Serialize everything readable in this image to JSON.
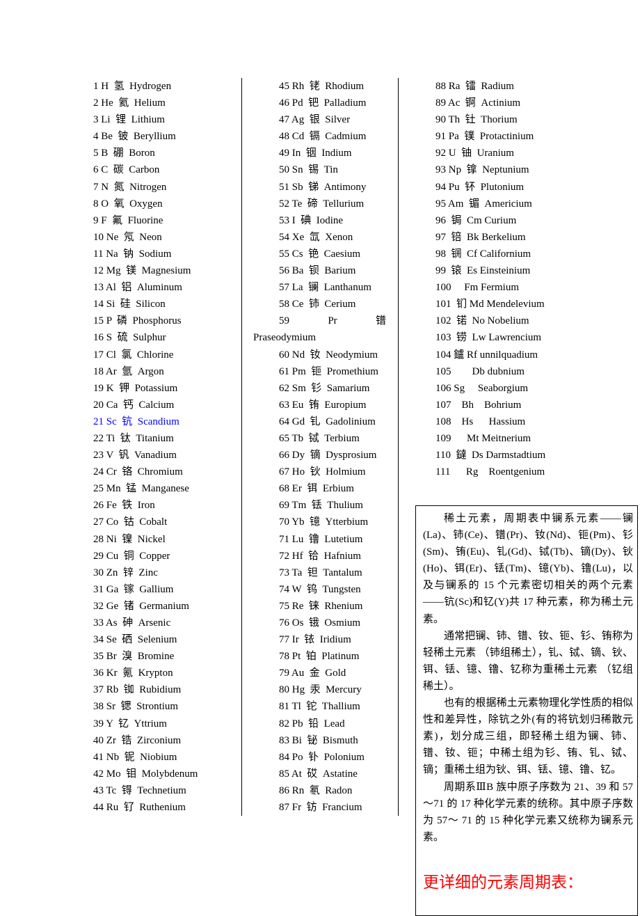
{
  "columns": [
    [
      "1 H  氢  Hydrogen",
      "2 He  氦  Helium",
      "3 Li  锂  Lithium",
      "4 Be  铍  Beryllium",
      "5 B  硼  Boron",
      "6 C  碳  Carbon",
      "7 N  氮  Nitrogen",
      "8 O  氧  Oxygen",
      "9 F  氟  Fluorine",
      "10 Ne  氖  Neon",
      "11 Na  钠  Sodium",
      "12 Mg  镁  Magnesium",
      "13 Al  铝  Aluminum",
      "14 Si  硅  Silicon",
      "15 P  磷  Phosphorus",
      "16 S  硫  Sulphur",
      "17 Cl  氯  Chlorine",
      "18 Ar  氩  Argon",
      "19 K  钾  Potassium",
      "20 Ca  钙  Calcium",
      "21 Sc  钪  Scandium",
      "22 Ti  钛  Titanium",
      "23 V  钒  Vanadium",
      "24 Cr  铬  Chromium",
      "25 Mn  锰  Manganese",
      "26 Fe  铁  Iron",
      "27 Co  钴  Cobalt",
      "28 Ni  镍  Nickel",
      "29 Cu  铜  Copper",
      "30 Zn  锌  Zinc",
      "31 Ga  镓  Gallium",
      "32 Ge  锗  Germanium",
      "33 As  砷  Arsenic",
      "34 Se  硒  Selenium",
      "35 Br  溴  Bromine",
      "36 Kr  氪  Krypton",
      "37 Rb  铷  Rubidium",
      "38 Sr  锶  Strontium",
      "39 Y  钇  Yttrium",
      "40 Zr  锆  Zirconium",
      "41 Nb  铌  Niobium",
      "42 Mo  钼  Molybdenum",
      "43 Tc  锝  Technetium",
      "44 Ru  钌  Ruthenium"
    ],
    [
      "45 Rh  铑  Rhodium",
      "46 Pd  钯  Palladium",
      "47 Ag  银  Silver",
      "48 Cd  镉  Cadmium",
      "49 In  铟  Indium",
      "50 Sn  锡  Tin",
      "51 Sb  锑  Antimony",
      "52 Te  碲  Tellurium",
      "53 I  碘  Iodine",
      "54 Xe  氙  Xenon",
      "55 Cs  铯  Caesium",
      "56 Ba  钡  Barium",
      "57 La  镧  Lanthanum",
      "58 Ce  铈  Cerium"
    ],
    [
      "60 Nd  钕  Neodymium",
      "61 Pm  钷  Promethium",
      "62 Sm  钐  Samarium",
      "63 Eu  铕  Europium",
      "64 Gd  钆  Gadolinium",
      "65 Tb  铽  Terbium",
      "66 Dy  镝  Dysprosium",
      "67 Ho  钬  Holmium",
      "68 Er  铒  Erbium",
      "69 Tm  铥  Thulium",
      "70 Yb  镱  Ytterbium",
      "71 Lu  镥  Lutetium",
      "72 Hf  铪  Hafnium",
      "73 Ta  钽  Tantalum",
      "74 W  钨  Tungsten",
      "75 Re  铼  Rhenium",
      "76 Os  锇  Osmium",
      "77 Ir  铱  Iridium",
      "78 Pt  铂  Platinum",
      "79 Au  金  Gold",
      "80 Hg  汞  Mercury",
      "81 Tl  铊  Thallium",
      "82 Pb  铅  Lead",
      "83 Bi  铋  Bismuth",
      "84 Po  钋  Polonium",
      "85 At  砹  Astatine",
      "86 Rn  氡  Radon",
      "87 Fr  钫  Francium"
    ],
    [
      "88 Ra  镭  Radium",
      "89 Ac  锕  Actinium",
      "90 Th  钍  Thorium",
      "91 Pa  镤  Protactinium",
      "92 U  铀  Uranium",
      "93 Np  镎  Neptunium",
      "94 Pu  钚  Plutonium",
      "95 Am  镅  Americium",
      "96  锔  Cm Curium",
      "97  锫  Bk Berkelium",
      "98  锎  Cf Californium",
      "99  锿  Es Einsteinium",
      "100     Fm Fermium",
      "101  钔 Md Mendelevium",
      "102  锘  No Nobelium",
      "103  铹  Lw Lawrencium",
      "104 鑪 Rf unnilquadium",
      "105        Db dubnium",
      "106 Sg     Seaborgium",
      "107    Bh    Bohrium",
      "108    Hs      Hassium",
      "109      Mt Meitnerium",
      "110  鐽  Ds Darmstadtium",
      "111      Rg    Roentgenium"
    ]
  ],
  "item59": {
    "num": "59",
    "sym": "Pr",
    "cn": "镨",
    "name": "Praseodymium"
  },
  "highlight_color": "#0000ff",
  "box": {
    "paragraphs": [
      "稀土元素，周期表中镧系元素——镧(La)、铈(Ce)、镨(Pr)、钕(Nd)、钷(Pm)、钐(Sm)、铕(Eu)、钆(Gd)、铽(Tb)、镝(Dy)、钬(Ho)、铒(Er)、铥(Tm)、镱(Yb)、镥(Lu)，以及与镧系的 15 个元素密切相关的两个元素——钪(Sc)和钇(Y)共 17 种元素，称为稀土元素。",
      "通常把镧、铈、镨、钕、钷、钐、铕称为轻稀土元素 （铈组稀土），钆、铽、镝、钬、铒、铥、镱、镥、钇称为重稀土元素 （钇组稀土）。",
      "也有的根据稀土元素物理化学性质的相似性和差异性，除钪之外(有的将钪划归稀散元素)，划分成三组，即轻稀土组为镧、铈、镨、钕、钷；中稀土组为钐、铕、钆、铽、镝；重稀土组为钬、铒、铥、镱、镥、钇。",
      "周期系ⅢB 族中原子序数为 21、39 和 57～71 的 17 种化学元素的统称。其中原子序数为 57～ 71 的 15 种化学元素又统称为镧系元素。"
    ],
    "more_link": "更详细的元素周期表：",
    "more_color": "#ff0000"
  }
}
